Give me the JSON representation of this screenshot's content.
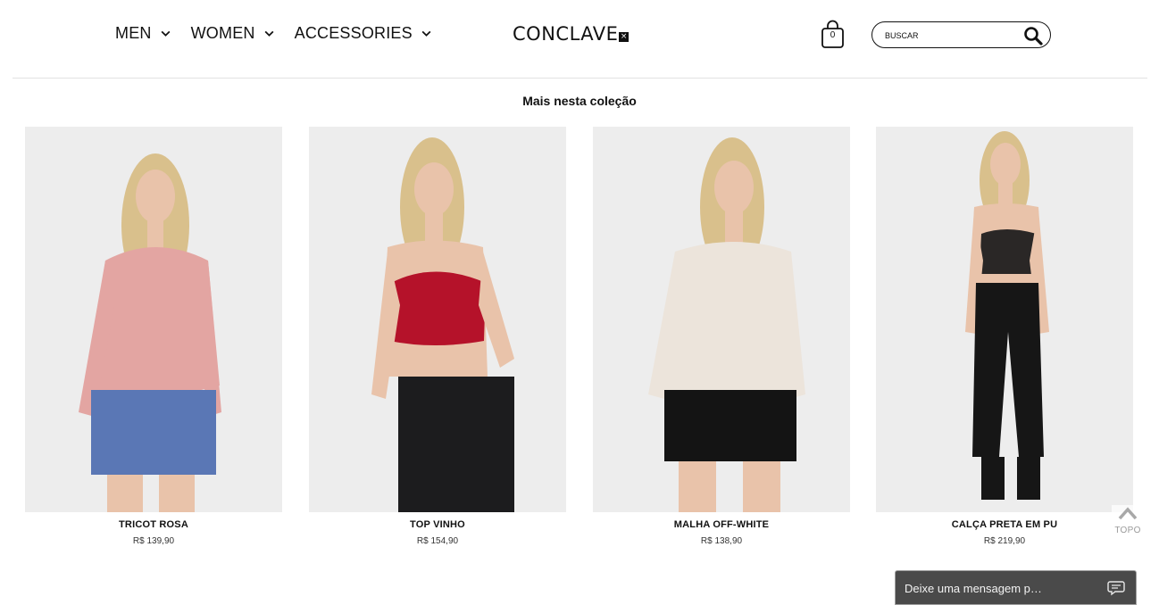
{
  "header": {
    "nav": [
      {
        "label": "MEN"
      },
      {
        "label": "WOMEN"
      },
      {
        "label": "ACCESSORIES"
      }
    ],
    "logo_text": "CONCLAVE",
    "logo_mark": "×",
    "cart_count": "0",
    "search_placeholder": "BUSCAR"
  },
  "section": {
    "title": "Mais nesta coleção"
  },
  "products": [
    {
      "name": "TRICOT ROSA",
      "price": "R$ 139,90",
      "top_color": "#e3a5a2",
      "bottom_color": "#5a77b5"
    },
    {
      "name": "TOP VINHO",
      "price": "R$ 154,90",
      "top_color": "#b5122a",
      "bottom_color": "#1c1c1e"
    },
    {
      "name": "MALHA OFF-WHITE",
      "price": "R$ 138,90",
      "top_color": "#ece4db",
      "bottom_color": "#141414"
    },
    {
      "name": "CALÇA PRETA EM PU",
      "price": "R$ 219,90",
      "top_color": "#2a2726",
      "bottom_color": "#161616"
    }
  ],
  "scroll_top_label": "TOPO",
  "chat": {
    "placeholder": "Deixe uma mensagem p…"
  },
  "colors": {
    "skin": "#e9c3aa",
    "hair": "#d9c08c",
    "photo_bg": "#ededed"
  }
}
